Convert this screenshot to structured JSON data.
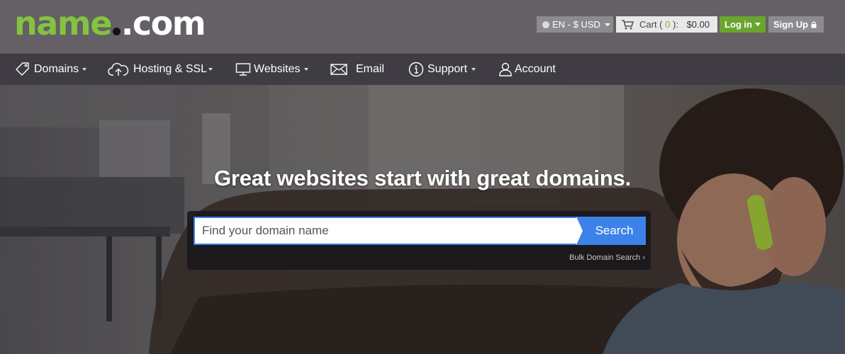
{
  "header": {
    "logo": {
      "name": "name",
      "com": ".com"
    },
    "language": {
      "label": "EN - $ USD",
      "icon": "globe-icon"
    },
    "cart": {
      "label": "Cart (",
      "count": "0",
      "close": "):",
      "total": "$0.00",
      "icon": "cart-icon"
    },
    "login_label": "Log in",
    "signup_label": "Sign Up",
    "colors": {
      "brand_green": "#84c33f",
      "login_green": "#6aa52f",
      "accent_blue": "#3d82e8"
    }
  },
  "nav": {
    "items": [
      {
        "label": "Domains",
        "icon": "tag-icon",
        "dropdown": true
      },
      {
        "label": "Hosting & SSL",
        "icon": "cloud-upload-icon",
        "dropdown": true
      },
      {
        "label": "Websites",
        "icon": "monitor-icon",
        "dropdown": true
      },
      {
        "label": "Email",
        "icon": "envelope-icon",
        "dropdown": false
      },
      {
        "label": "Support",
        "icon": "info-icon",
        "dropdown": true
      },
      {
        "label": "Account",
        "icon": "user-icon",
        "dropdown": false
      }
    ]
  },
  "hero": {
    "headline": "Great websites start with great domains.",
    "search": {
      "placeholder": "Find your domain name",
      "value": "",
      "button_label": "Search",
      "bulk_link": "Bulk Domain Search ›"
    }
  }
}
